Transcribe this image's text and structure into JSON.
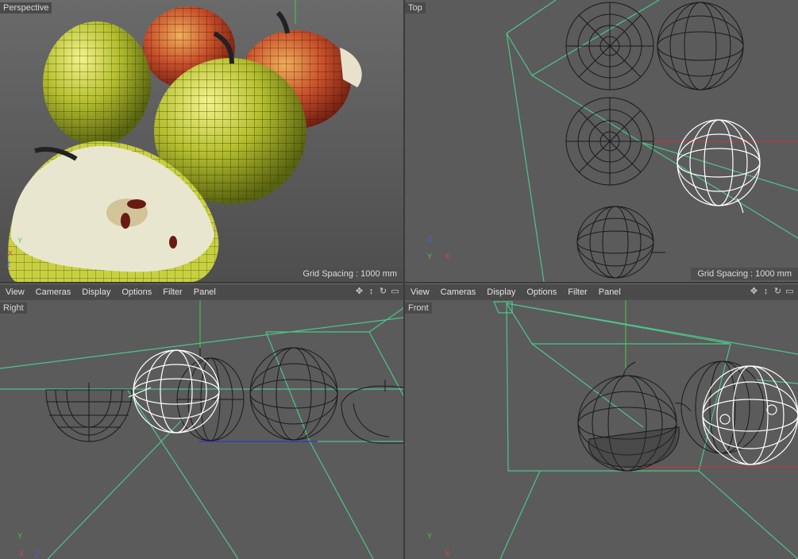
{
  "viewports": {
    "perspective": {
      "label": "Perspective",
      "grid_spacing": "Grid Spacing : 1000 mm"
    },
    "top": {
      "label": "Top",
      "grid_spacing": "Grid Spacing : 1000 mm"
    },
    "right": {
      "label": "Right"
    },
    "front": {
      "label": "Front"
    }
  },
  "menus": {
    "left": [
      "View",
      "Cameras",
      "Display",
      "Options",
      "Filter",
      "Panel"
    ],
    "right": [
      "View",
      "Cameras",
      "Display",
      "Options",
      "Filter",
      "Panel"
    ]
  },
  "axes": {
    "x": "X",
    "y": "Y",
    "z": "Z"
  },
  "icons": [
    "move-icon",
    "zoom-icon",
    "rotate-icon",
    "maximize-icon"
  ],
  "colors": {
    "viewport_bg": "#5b5b5b",
    "menubar_bg": "#4a4a4a",
    "camera_frustum": "#4fc48a",
    "selected_wire": "#ffffff",
    "axis_x": "#d44",
    "axis_y": "#4c4",
    "axis_z": "#55f"
  }
}
